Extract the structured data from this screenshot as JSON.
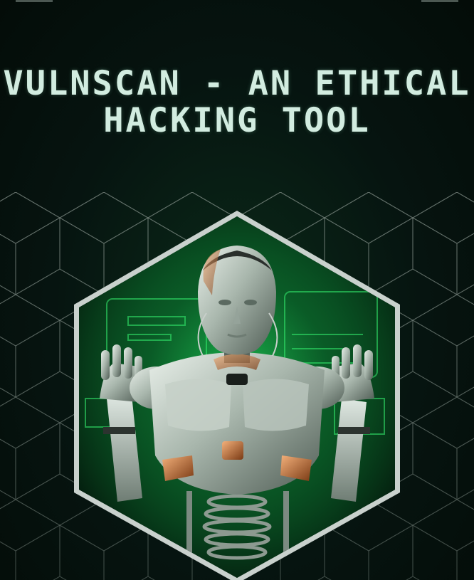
{
  "title": "VULNSCAN - AN ETHICAL HACKING TOOL",
  "colors": {
    "background": "#071510",
    "title": "#d2ece0",
    "grid_lines": "#8e9a94",
    "frame": "#c9d1cd",
    "accent_green": "#1fd65a"
  },
  "image": {
    "subject": "humanoid-robot-illustration"
  }
}
